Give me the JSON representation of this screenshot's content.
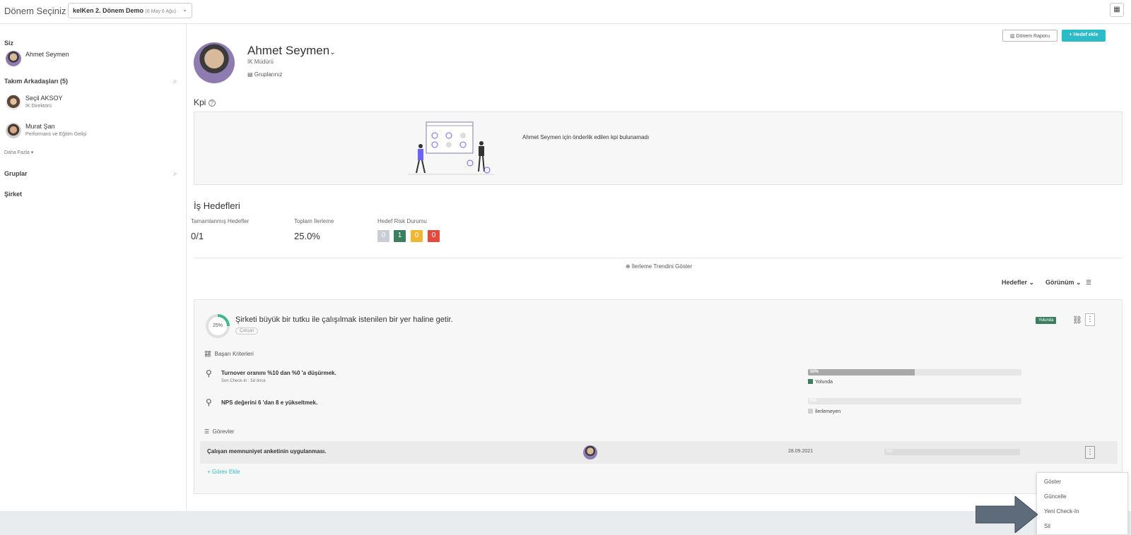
{
  "topbar": {
    "period_label": "Dönem Seçiniz :",
    "period_value": "kelKen 2. Dönem Demo",
    "period_dates": "(6 May 6 Ağu)"
  },
  "sidebar": {
    "you_heading": "Siz",
    "me": {
      "name": "Ahmet Seymen"
    },
    "team_heading": "Takım Arkadaşları (5)",
    "team": [
      {
        "name": "Seçil AKSOY",
        "role": "İK Direktörü"
      },
      {
        "name": "Murat Şan",
        "role": "Performans ve Eğitim Gelişi"
      }
    ],
    "more": "Daha Fazla",
    "groups_heading": "Gruplar",
    "company_heading": "Şirket"
  },
  "actions": {
    "report": "Dönem Raporu",
    "add_goal": "Hedef ekle"
  },
  "profile": {
    "name": "Ahmet Seymen",
    "role": "İK Müdürü",
    "groups": "Gruplarınız"
  },
  "kpi": {
    "title": "Kpi",
    "empty_message": "Ahmet Seymen için önderlik edilen kpi bulunamadı"
  },
  "goals": {
    "title": "İş Hedefleri",
    "completed_label": "Tamamlanmış Hedefler",
    "completed_value": "0/1",
    "progress_label": "Toplam İlerleme",
    "progress_value": "25.0%",
    "risk_label": "Hedef Risk Durumu",
    "risk": [
      {
        "value": "0",
        "color": "#c9cdd6"
      },
      {
        "value": "1",
        "color": "#3b7f5f"
      },
      {
        "value": "0",
        "color": "#f2b632"
      },
      {
        "value": "0",
        "color": "#e24c3f"
      }
    ],
    "trend": "İlerleme Trendini Göster",
    "toolbar": {
      "goals": "Hedefler",
      "view": "Görünüm"
    }
  },
  "goal_card": {
    "percent": "25%",
    "percent_value": 25,
    "title": "Şirketi büyük bir tutku ile çalışılmak istenilen bir yer haline getir.",
    "tag": "Çalışan",
    "status": "Yolunda",
    "criteria_heading": "Başarı Kriterleri",
    "criteria": [
      {
        "title": "Turnover oranını %10 dan %0 'a düşürmek.",
        "sub": "Son Check-In : 5d önce",
        "progress": "50%",
        "progress_value": 50,
        "status": "Yolunda",
        "status_color": "#3b7f5f"
      },
      {
        "title": "NPS değerini 6 'dan 8 e yükseltmek.",
        "sub": "",
        "progress": "0%",
        "progress_value": 0,
        "status": "İlerlemeyen",
        "status_color": "#cfcfcf"
      }
    ],
    "tasks_heading": "Görevler",
    "task": {
      "title": "Çalışan memnuniyet anketinin uygulanması.",
      "date": "28.09.2021",
      "progress": "%0"
    },
    "add_task": "+ Görev Ekle"
  },
  "menu": {
    "items": [
      "Göster",
      "Güncelle",
      "Yeni Check-In",
      "Sil"
    ]
  },
  "colors": {
    "accent": "#2bbbc9",
    "ok": "#3b7f5f"
  }
}
